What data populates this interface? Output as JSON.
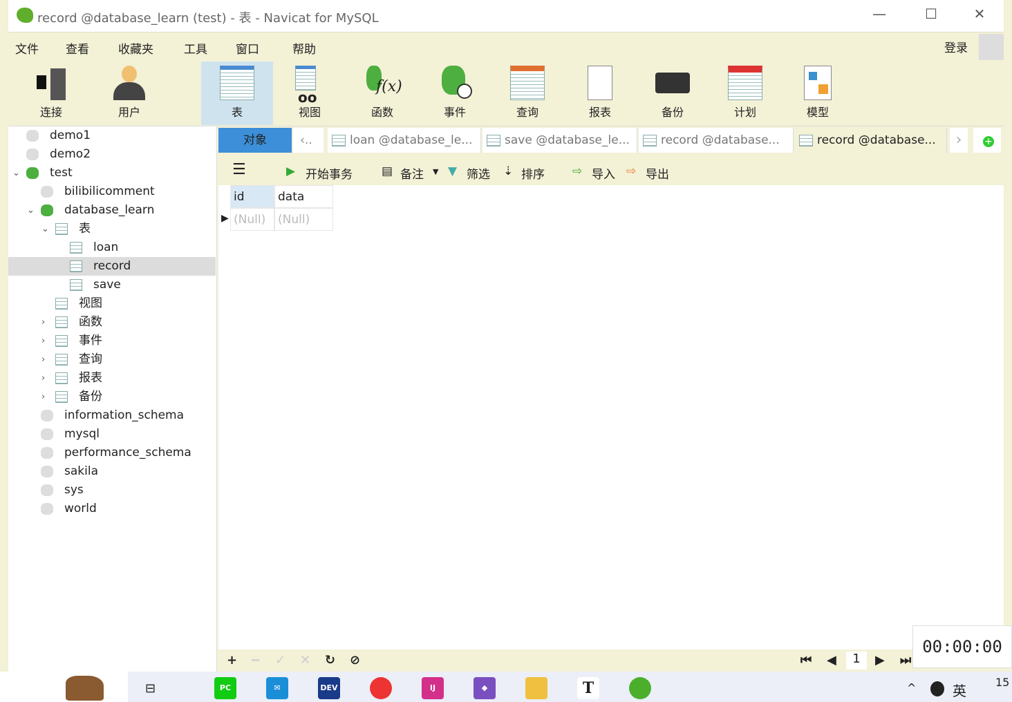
{
  "window": {
    "title": "record @database_learn (test) - 表 - Navicat for MySQL",
    "minimize": "—",
    "maximize": "☐",
    "close": "✕"
  },
  "menu": [
    "文件",
    "查看",
    "收藏夹",
    "工具",
    "窗口",
    "帮助"
  ],
  "login": "登录",
  "toolbar": [
    "连接",
    "用户",
    "表",
    "视图",
    "函数",
    "事件",
    "查询",
    "报表",
    "备份",
    "计划",
    "模型"
  ],
  "tree": [
    {
      "label": "demo1",
      "level": 0,
      "icon": "db-grey"
    },
    {
      "label": "demo2",
      "level": 0,
      "icon": "db-grey"
    },
    {
      "label": "test",
      "level": 0,
      "icon": "connection-green",
      "expanded": true
    },
    {
      "label": "bilibilicomment",
      "level": 1,
      "icon": "db-grey"
    },
    {
      "label": "database_learn",
      "level": 1,
      "icon": "db-green",
      "expanded": true
    },
    {
      "label": "表",
      "level": 2,
      "icon": "table",
      "expanded": true
    },
    {
      "label": "loan",
      "level": 3,
      "icon": "table"
    },
    {
      "label": "record",
      "level": 3,
      "icon": "table",
      "selected": true
    },
    {
      "label": "save",
      "level": 3,
      "icon": "table"
    },
    {
      "label": "视图",
      "level": 2,
      "icon": "view"
    },
    {
      "label": "函数",
      "level": 2,
      "icon": "function",
      "collapsed": true
    },
    {
      "label": "事件",
      "level": 2,
      "icon": "event",
      "collapsed": true
    },
    {
      "label": "查询",
      "level": 2,
      "icon": "query",
      "collapsed": true
    },
    {
      "label": "报表",
      "level": 2,
      "icon": "report",
      "collapsed": true
    },
    {
      "label": "备份",
      "level": 2,
      "icon": "backup",
      "collapsed": true
    },
    {
      "label": "information_schema",
      "level": 1,
      "icon": "db-grey"
    },
    {
      "label": "mysql",
      "level": 1,
      "icon": "db-grey"
    },
    {
      "label": "performance_schema",
      "level": 1,
      "icon": "db-grey"
    },
    {
      "label": "sakila",
      "level": 1,
      "icon": "db-grey"
    },
    {
      "label": "sys",
      "level": 1,
      "icon": "db-grey"
    },
    {
      "label": "world",
      "level": 1,
      "icon": "db-grey"
    }
  ],
  "tabs": {
    "objects": "对象",
    "overflow": "..",
    "items": [
      "loan @database_le...",
      "save @database_le...",
      "record @database...",
      "record @database..."
    ]
  },
  "objtoolbar": {
    "begin": "开始事务",
    "memo": "备注",
    "filter": "筛选",
    "sort": "排序",
    "import": "导入",
    "export": "导出"
  },
  "grid": {
    "columns": [
      "id",
      "data"
    ],
    "rows": [
      [
        "(Null)",
        "(Null)"
      ]
    ]
  },
  "pager": {
    "page": "1"
  },
  "timer": "00:00:00",
  "taskbar": {
    "ime": "英",
    "clock": "15"
  },
  "colors": {
    "accent": "#3c8fd8",
    "selected_tab": "#3c8fd8",
    "toolbar_bg": "#f3f1d6"
  }
}
